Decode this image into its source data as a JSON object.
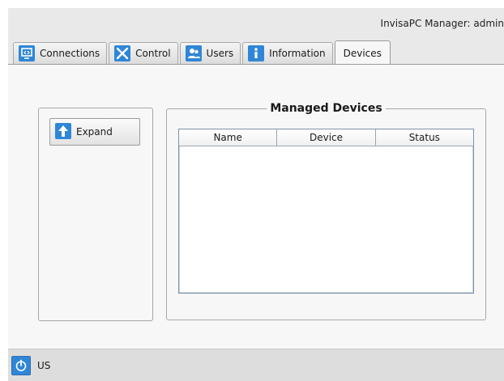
{
  "window": {
    "title": "InvisaPC Manager: admin"
  },
  "tabs": [
    {
      "label": "Connections",
      "icon": "connections-icon",
      "active": false
    },
    {
      "label": "Control",
      "icon": "control-icon",
      "active": false
    },
    {
      "label": "Users",
      "icon": "users-icon",
      "active": false
    },
    {
      "label": "Information",
      "icon": "info-icon",
      "active": false
    },
    {
      "label": "Devices",
      "icon": "",
      "active": true
    }
  ],
  "devices": {
    "expand_label": "Expand",
    "group_title": "Managed Devices",
    "columns": [
      "Name",
      "Device",
      "Status"
    ],
    "rows": []
  },
  "statusbar": {
    "keyboard_layout": "US"
  },
  "colors": {
    "accent": "#2f86d6",
    "panel": "#f7f7f7",
    "chrome": "#e9e9e9"
  }
}
